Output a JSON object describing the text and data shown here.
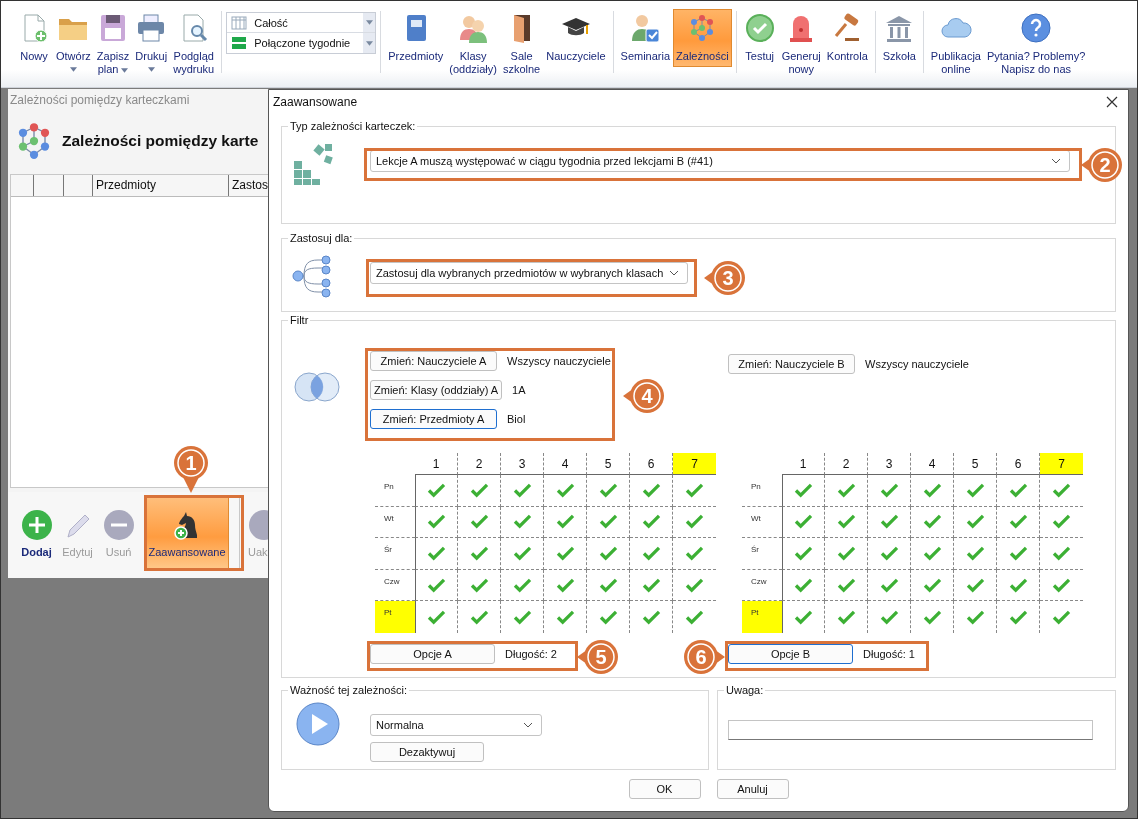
{
  "toolbar": {
    "groups": [
      {
        "kind": "buttons",
        "items": [
          {
            "lines": [
              "Nowy"
            ],
            "has_menu": false,
            "selected": false
          },
          {
            "lines": [
              "Otwórz"
            ],
            "has_menu": true,
            "selected": false
          },
          {
            "lines": [
              "Zapisz",
              "plan"
            ],
            "has_menu": true,
            "selected": false
          },
          {
            "lines": [
              "Drukuj"
            ],
            "has_menu": true,
            "selected": false
          },
          {
            "lines": [
              "Podgląd",
              "wydruku"
            ],
            "has_menu": false,
            "selected": false
          }
        ]
      },
      {
        "kind": "combos",
        "items": [
          {
            "value": "Całość"
          },
          {
            "value": "Połączone tygodnie"
          }
        ]
      },
      {
        "kind": "buttons",
        "items": [
          {
            "lines": [
              "Przedmioty"
            ],
            "has_menu": false,
            "selected": false
          },
          {
            "lines": [
              "Klasy",
              "(oddziały)"
            ],
            "has_menu": false,
            "selected": false
          },
          {
            "lines": [
              "Sale",
              "szkolne"
            ],
            "has_menu": false,
            "selected": false
          },
          {
            "lines": [
              "Nauczyciele"
            ],
            "has_menu": false,
            "selected": false
          }
        ]
      },
      {
        "kind": "buttons",
        "items": [
          {
            "lines": [
              "Seminaria"
            ],
            "has_menu": false,
            "selected": false
          },
          {
            "lines": [
              "Zależności"
            ],
            "has_menu": false,
            "selected": true
          }
        ]
      },
      {
        "kind": "buttons",
        "items": [
          {
            "lines": [
              "Testuj"
            ],
            "has_menu": false,
            "selected": false
          },
          {
            "lines": [
              "Generuj",
              "nowy"
            ],
            "has_menu": false,
            "selected": false
          },
          {
            "lines": [
              "Kontrola"
            ],
            "has_menu": false,
            "selected": false
          }
        ]
      },
      {
        "kind": "buttons",
        "items": [
          {
            "lines": [
              "Szkoła"
            ],
            "has_menu": false,
            "selected": false
          }
        ]
      },
      {
        "kind": "buttons",
        "items": [
          {
            "lines": [
              "Publikacja",
              "online"
            ],
            "has_menu": false,
            "selected": false
          },
          {
            "lines": [
              "Pytania? Problemy?",
              "Napisz do nas"
            ],
            "has_menu": false,
            "selected": false
          }
        ]
      }
    ]
  },
  "list_window": {
    "title": "Zależności pomiędzy karteczkami",
    "heading": "Zależności pomiędzy karte",
    "columns": [
      "Przedmioty",
      "Zastos"
    ],
    "actions": [
      {
        "label": "Dodaj",
        "disabled": false,
        "selected": false
      },
      {
        "label": "Edytuj",
        "disabled": true,
        "selected": false
      },
      {
        "label": "Usuń",
        "disabled": true,
        "selected": false
      },
      {
        "label": "Zaawansowane",
        "disabled": false,
        "selected": true
      },
      {
        "label": "Uak",
        "disabled": true,
        "selected": false
      }
    ]
  },
  "dialog": {
    "title": "Zaawansowane",
    "type_section": {
      "legend": "Typ zależności karteczek:",
      "value": "Lekcje A muszą występować w ciągu tygodnia przed lekcjami B (#41)"
    },
    "apply_section": {
      "legend": "Zastosuj dla:",
      "value": "Zastosuj dla wybranych przedmiotów w wybranych klasach"
    },
    "filter": {
      "legend": "Filtr",
      "sides": [
        {
          "rows": [
            {
              "button": "Zmień: Nauczyciele A",
              "value": "Wszyscy nauczyciele",
              "focused": false
            },
            {
              "button": "Zmień: Klasy (oddziały) A",
              "value": "1A",
              "focused": false
            },
            {
              "button": "Zmień: Przedmioty A",
              "value": "Biol",
              "focused": true
            }
          ],
          "grid": {
            "periods": [
              {
                "label": "1",
                "highlighted": false
              },
              {
                "label": "2",
                "highlighted": false
              },
              {
                "label": "3",
                "highlighted": false
              },
              {
                "label": "4",
                "highlighted": false
              },
              {
                "label": "5",
                "highlighted": false
              },
              {
                "label": "6",
                "highlighted": false
              },
              {
                "label": "7",
                "highlighted": true
              }
            ],
            "days": [
              {
                "label": "Pn",
                "highlighted": false,
                "cells": [
                  {
                    "checked": true
                  },
                  {
                    "checked": true
                  },
                  {
                    "checked": true
                  },
                  {
                    "checked": true
                  },
                  {
                    "checked": true
                  },
                  {
                    "checked": true
                  },
                  {
                    "checked": true
                  }
                ]
              },
              {
                "label": "Wt",
                "highlighted": false,
                "cells": [
                  {
                    "checked": true
                  },
                  {
                    "checked": true
                  },
                  {
                    "checked": true
                  },
                  {
                    "checked": true
                  },
                  {
                    "checked": true
                  },
                  {
                    "checked": true
                  },
                  {
                    "checked": true
                  }
                ]
              },
              {
                "label": "Śr",
                "highlighted": false,
                "cells": [
                  {
                    "checked": true
                  },
                  {
                    "checked": true
                  },
                  {
                    "checked": true
                  },
                  {
                    "checked": true
                  },
                  {
                    "checked": true
                  },
                  {
                    "checked": true
                  },
                  {
                    "checked": true
                  }
                ]
              },
              {
                "label": "Czw",
                "highlighted": false,
                "cells": [
                  {
                    "checked": true
                  },
                  {
                    "checked": true
                  },
                  {
                    "checked": true
                  },
                  {
                    "checked": true
                  },
                  {
                    "checked": true
                  },
                  {
                    "checked": true
                  },
                  {
                    "checked": true
                  }
                ]
              },
              {
                "label": "Pt",
                "highlighted": true,
                "cells": [
                  {
                    "checked": true
                  },
                  {
                    "checked": true
                  },
                  {
                    "checked": true
                  },
                  {
                    "checked": true
                  },
                  {
                    "checked": true
                  },
                  {
                    "checked": true
                  },
                  {
                    "checked": true
                  }
                ]
              }
            ]
          },
          "options_button": "Opcje A",
          "options_focused": false,
          "length": "Długość: 2"
        },
        {
          "rows": [
            {
              "button": "Zmień: Nauczyciele B",
              "value": "Wszyscy nauczyciele",
              "focused": false
            }
          ],
          "grid": {
            "periods": [
              {
                "label": "1",
                "highlighted": false
              },
              {
                "label": "2",
                "highlighted": false
              },
              {
                "label": "3",
                "highlighted": false
              },
              {
                "label": "4",
                "highlighted": false
              },
              {
                "label": "5",
                "highlighted": false
              },
              {
                "label": "6",
                "highlighted": false
              },
              {
                "label": "7",
                "highlighted": true
              }
            ],
            "days": [
              {
                "label": "Pn",
                "highlighted": false,
                "cells": [
                  {
                    "checked": true
                  },
                  {
                    "checked": true
                  },
                  {
                    "checked": true
                  },
                  {
                    "checked": true
                  },
                  {
                    "checked": true
                  },
                  {
                    "checked": true
                  },
                  {
                    "checked": true
                  }
                ]
              },
              {
                "label": "Wt",
                "highlighted": false,
                "cells": [
                  {
                    "checked": true
                  },
                  {
                    "checked": true
                  },
                  {
                    "checked": true
                  },
                  {
                    "checked": true
                  },
                  {
                    "checked": true
                  },
                  {
                    "checked": true
                  },
                  {
                    "checked": true
                  }
                ]
              },
              {
                "label": "Śr",
                "highlighted": false,
                "cells": [
                  {
                    "checked": true
                  },
                  {
                    "checked": true
                  },
                  {
                    "checked": true
                  },
                  {
                    "checked": true
                  },
                  {
                    "checked": true
                  },
                  {
                    "checked": true
                  },
                  {
                    "checked": true
                  }
                ]
              },
              {
                "label": "Czw",
                "highlighted": false,
                "cells": [
                  {
                    "checked": true
                  },
                  {
                    "checked": true
                  },
                  {
                    "checked": true
                  },
                  {
                    "checked": true
                  },
                  {
                    "checked": true
                  },
                  {
                    "checked": true
                  },
                  {
                    "checked": true
                  }
                ]
              },
              {
                "label": "Pt",
                "highlighted": true,
                "cells": [
                  {
                    "checked": true
                  },
                  {
                    "checked": true
                  },
                  {
                    "checked": true
                  },
                  {
                    "checked": true
                  },
                  {
                    "checked": true
                  },
                  {
                    "checked": true
                  },
                  {
                    "checked": true
                  }
                ]
              }
            ]
          },
          "options_button": "Opcje B",
          "options_focused": true,
          "length": "Długość: 1"
        }
      ]
    },
    "importance": {
      "legend": "Ważność tej zależności:",
      "value": "Normalna",
      "button": "Dezaktywuj"
    },
    "note": {
      "legend": "Uwaga:"
    },
    "buttons": [
      "OK",
      "Anuluj"
    ]
  },
  "callouts": [
    {
      "number": "1"
    },
    {
      "number": "2"
    },
    {
      "number": "3"
    },
    {
      "number": "4"
    },
    {
      "number": "5"
    },
    {
      "number": "6"
    }
  ]
}
